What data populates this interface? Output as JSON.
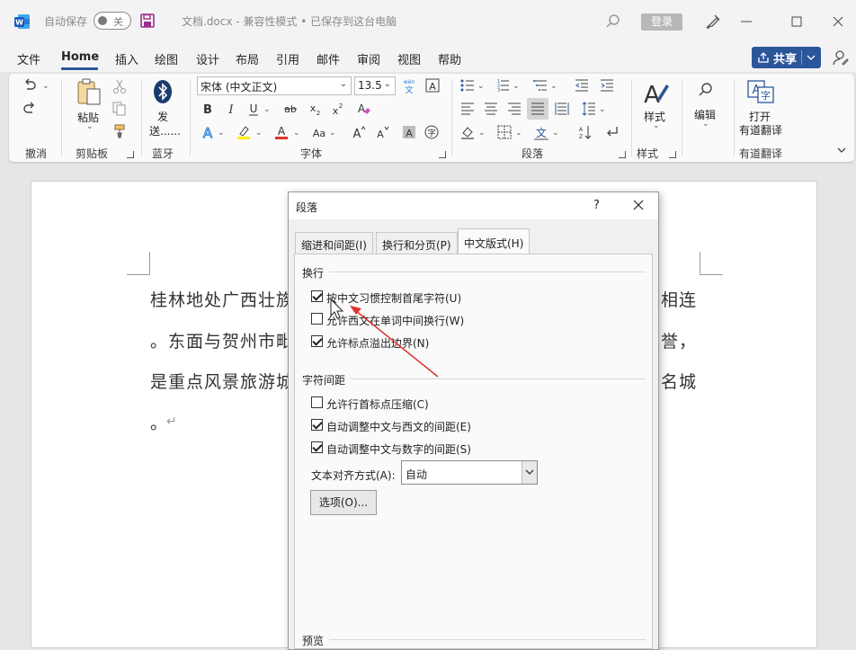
{
  "titlebar": {
    "autosave_label": "自动保存",
    "autosave_toggle": "关",
    "doc_title": "文档.docx  -  兼容性模式 • 已保存到这台电脑",
    "login": "登录"
  },
  "menu": {
    "items": [
      "文件",
      "Home",
      "插入",
      "绘图",
      "设计",
      "布局",
      "引用",
      "邮件",
      "审阅",
      "视图",
      "帮助"
    ],
    "active": "Home",
    "share": "共享"
  },
  "ribbon": {
    "undo_group": "撤消",
    "clipboard_group": "剪贴板",
    "paste": "粘贴",
    "bluetooth_group": "蓝牙",
    "send_1": "发",
    "send_2": "送......",
    "font_name": "宋体 (中文正文)",
    "font_size": "13.5",
    "font_group": "字体",
    "paragraph_group": "段落",
    "styles": "样式",
    "styles_group": "样式",
    "edit": "编辑",
    "translate_1": "打开",
    "translate_2": "有道翻译",
    "translate_group": "有道翻译",
    "accent_color": "#2b579a"
  },
  "document": {
    "lines": [
      "桂林地处广西壮族",
      "相连",
      "。东面与贺州市毗",
      "誉，",
      "是重点风景旅游城",
      "名城",
      "。"
    ]
  },
  "dialog": {
    "title": "段落",
    "help": "?",
    "tabs": [
      "缩进和间距(I)",
      "换行和分页(P)",
      "中文版式(H)"
    ],
    "active_tab": "中文版式(H)",
    "section_wrap": "换行",
    "section_spacing": "字符间距",
    "section_preview": "预览",
    "options": [
      {
        "label": "按中文习惯控制首尾字符(U)",
        "checked": true
      },
      {
        "label": "允许西文在单词中间换行(W)",
        "checked": false
      },
      {
        "label": "允许标点溢出边界(N)",
        "checked": true
      },
      {
        "label": "允许行首标点压缩(C)",
        "checked": false
      },
      {
        "label": "自动调整中文与西文的间距(E)",
        "checked": true
      },
      {
        "label": "自动调整中文与数字的间距(S)",
        "checked": true
      }
    ],
    "align_label": "文本对齐方式(A):",
    "align_value": "自动",
    "options_button": "选项(O)...",
    "annotation_color": "#e0342c"
  }
}
